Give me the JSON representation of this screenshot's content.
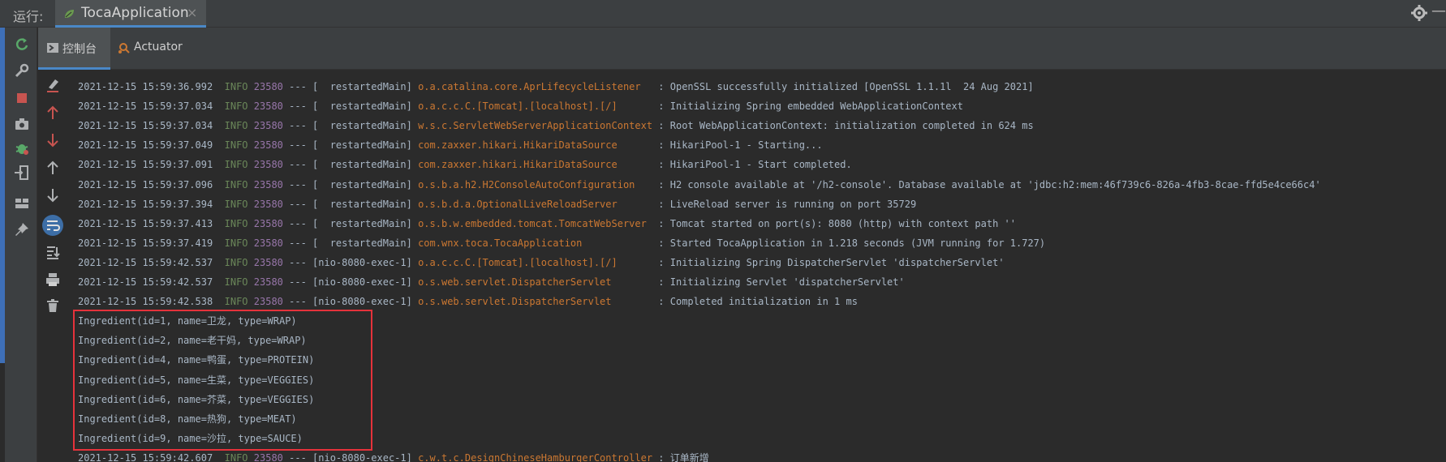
{
  "runbar": {
    "label": "运行:",
    "tab_title": "TocaApplication",
    "tab_close": "×",
    "minimize": "—"
  },
  "console_tabs": [
    {
      "label": "控制台",
      "icon": "console-icon",
      "active": true
    },
    {
      "label": "Actuator",
      "icon": "actuator-icon",
      "active": false
    }
  ],
  "left_tools": [
    "rerun-icon",
    "wrench-icon",
    "stop-icon",
    "camera-icon",
    "debug-bug-icon",
    "exit-icon",
    "layout-icon",
    "pin-icon"
  ],
  "console_tools": [
    "clear-brush-icon",
    "arrow-up-red-icon",
    "arrow-down-red-icon",
    "arrow-up-icon",
    "arrow-down-icon",
    "soft-wrap-icon",
    "scroll-to-end-icon",
    "print-icon",
    "trash-icon"
  ],
  "colors": {
    "timestamp": "#a9b7c6",
    "level": "#6a8759",
    "pid": "#9876aa",
    "logger": "#cc7832",
    "message": "#a9b7c6",
    "highlight": "#e5323b",
    "accent": "#4a88c7"
  },
  "log_lines": [
    {
      "ts": "2021-12-15 15:59:36.992",
      "level": "INFO",
      "pid": "23580",
      "thread": "--- [  restartedMain]",
      "logger": "o.a.catalina.core.AprLifecycleListener  ",
      "msg": ": OpenSSL successfully initialized [OpenSSL 1.1.1l  24 Aug 2021]"
    },
    {
      "ts": "2021-12-15 15:59:37.034",
      "level": "INFO",
      "pid": "23580",
      "thread": "--- [  restartedMain]",
      "logger": "o.a.c.c.C.[Tomcat].[localhost].[/]      ",
      "msg": ": Initializing Spring embedded WebApplicationContext"
    },
    {
      "ts": "2021-12-15 15:59:37.034",
      "level": "INFO",
      "pid": "23580",
      "thread": "--- [  restartedMain]",
      "logger": "w.s.c.ServletWebServerApplicationContext",
      "msg": ": Root WebApplicationContext: initialization completed in 624 ms"
    },
    {
      "ts": "2021-12-15 15:59:37.049",
      "level": "INFO",
      "pid": "23580",
      "thread": "--- [  restartedMain]",
      "logger": "com.zaxxer.hikari.HikariDataSource      ",
      "msg": ": HikariPool-1 - Starting..."
    },
    {
      "ts": "2021-12-15 15:59:37.091",
      "level": "INFO",
      "pid": "23580",
      "thread": "--- [  restartedMain]",
      "logger": "com.zaxxer.hikari.HikariDataSource      ",
      "msg": ": HikariPool-1 - Start completed."
    },
    {
      "ts": "2021-12-15 15:59:37.096",
      "level": "INFO",
      "pid": "23580",
      "thread": "--- [  restartedMain]",
      "logger": "o.s.b.a.h2.H2ConsoleAutoConfiguration   ",
      "msg": ": H2 console available at '/h2-console'. Database available at 'jdbc:h2:mem:46f739c6-826a-4fb3-8cae-ffd5e4ce66c4'"
    },
    {
      "ts": "2021-12-15 15:59:37.394",
      "level": "INFO",
      "pid": "23580",
      "thread": "--- [  restartedMain]",
      "logger": "o.s.b.d.a.OptionalLiveReloadServer      ",
      "msg": ": LiveReload server is running on port 35729"
    },
    {
      "ts": "2021-12-15 15:59:37.413",
      "level": "INFO",
      "pid": "23580",
      "thread": "--- [  restartedMain]",
      "logger": "o.s.b.w.embedded.tomcat.TomcatWebServer ",
      "msg": ": Tomcat started on port(s): 8080 (http) with context path ''"
    },
    {
      "ts": "2021-12-15 15:59:37.419",
      "level": "INFO",
      "pid": "23580",
      "thread": "--- [  restartedMain]",
      "logger": "com.wnx.toca.TocaApplication            ",
      "msg": ": Started TocaApplication in 1.218 seconds (JVM running for 1.727)"
    },
    {
      "ts": "2021-12-15 15:59:42.537",
      "level": "INFO",
      "pid": "23580",
      "thread": "--- [nio-8080-exec-1]",
      "logger": "o.a.c.c.C.[Tomcat].[localhost].[/]      ",
      "msg": ": Initializing Spring DispatcherServlet 'dispatcherServlet'"
    },
    {
      "ts": "2021-12-15 15:59:42.537",
      "level": "INFO",
      "pid": "23580",
      "thread": "--- [nio-8080-exec-1]",
      "logger": "o.s.web.servlet.DispatcherServlet       ",
      "msg": ": Initializing Servlet 'dispatcherServlet'"
    },
    {
      "ts": "2021-12-15 15:59:42.538",
      "level": "INFO",
      "pid": "23580",
      "thread": "--- [nio-8080-exec-1]",
      "logger": "o.s.web.servlet.DispatcherServlet       ",
      "msg": ": Completed initialization in 1 ms"
    }
  ],
  "ingredient_lines": [
    "Ingredient(id=1, name=卫龙, type=WRAP)",
    "Ingredient(id=2, name=老干妈, type=WRAP)",
    "Ingredient(id=4, name=鸭蛋, type=PROTEIN)",
    "Ingredient(id=5, name=生菜, type=VEGGIES)",
    "Ingredient(id=6, name=芥菜, type=VEGGIES)",
    "Ingredient(id=8, name=热狗, type=MEAT)",
    "Ingredient(id=9, name=沙拉, type=SAUCE)"
  ],
  "last_line": {
    "ts": "2021-12-15 15:59:42.607",
    "level": "INFO",
    "pid": "23580",
    "thread": "--- [nio-8080-exec-1]",
    "logger": "c.w.t.c.DesignChineseHamburgerController",
    "msg": ": 订单新增"
  }
}
